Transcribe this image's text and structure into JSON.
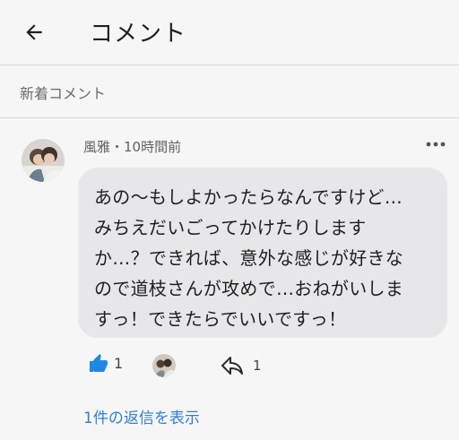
{
  "header": {
    "title": "コメント",
    "back_icon": "arrow-left-icon"
  },
  "section": {
    "label": "新着コメント"
  },
  "comment": {
    "meta": "風雅・10時間前",
    "text": "あの〜もしよかったらなんですけど…\nみちえだいごってかけたりします\nか…？できれば、意外な感じが好きな\nので道枝さんが攻めで…おねがいしま\nすっ！できたらでいいですっ！",
    "like_count": "1",
    "reply_count": "1",
    "show_replies": "1件の返信を表示"
  },
  "colors": {
    "accent": "#2f7ddc",
    "like_blue": "#1f88e5",
    "bubble": "#e7e7e9",
    "background": "#f6f6f6"
  }
}
